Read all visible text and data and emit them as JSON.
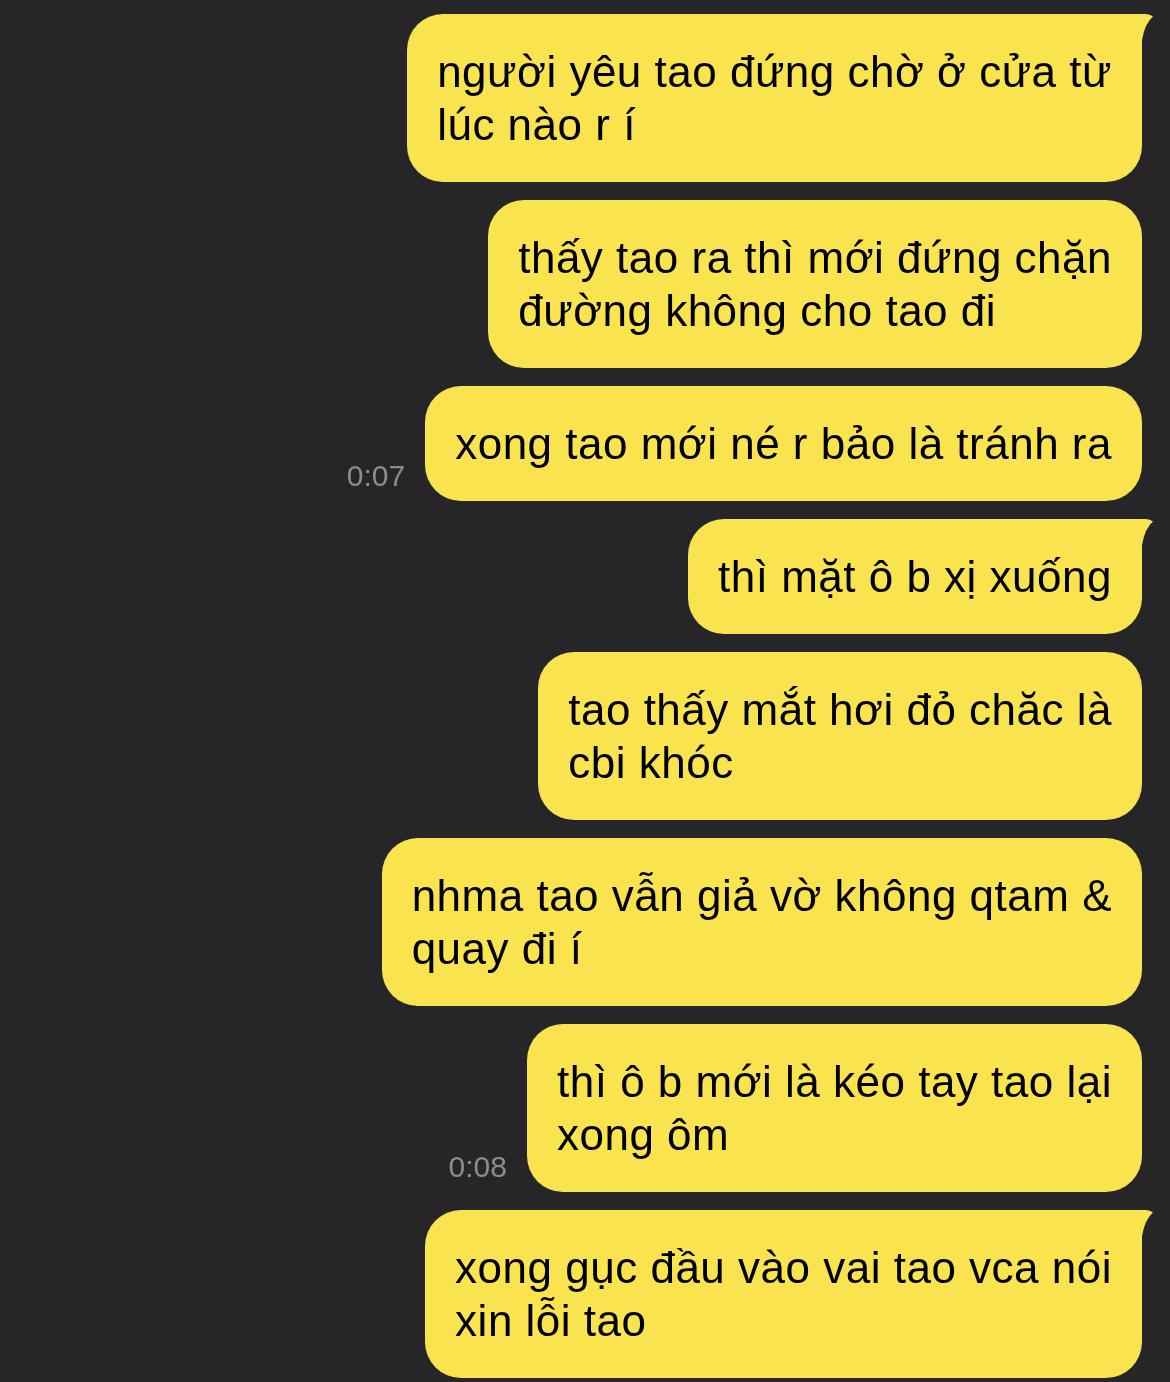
{
  "messages": [
    {
      "text": "người yêu tao đứng chờ ở cửa từ\nlúc nào r í",
      "tail": true
    },
    {
      "text": "thấy tao ra thì mới đứng chặn\nđường không cho tao đi",
      "tail": false
    },
    {
      "text": "xong tao mới né r bảo là tránh ra",
      "tail": false,
      "time": "0:07"
    },
    {
      "text": "thì mặt ô b xị xuống",
      "tail": true
    },
    {
      "text": "tao thấy mắt hơi đỏ chăc là\ncbi khóc",
      "tail": false
    },
    {
      "text": "nhma tao vẫn giả vờ không qtam &\nquay đi í",
      "tail": false
    },
    {
      "text": "thì ô b mới là kéo tay tao lại\nxong ôm",
      "tail": false,
      "time": "0:08"
    },
    {
      "text": "xong gục đầu vào vai tao vca nói\nxin lỗi tao",
      "tail": true
    }
  ]
}
